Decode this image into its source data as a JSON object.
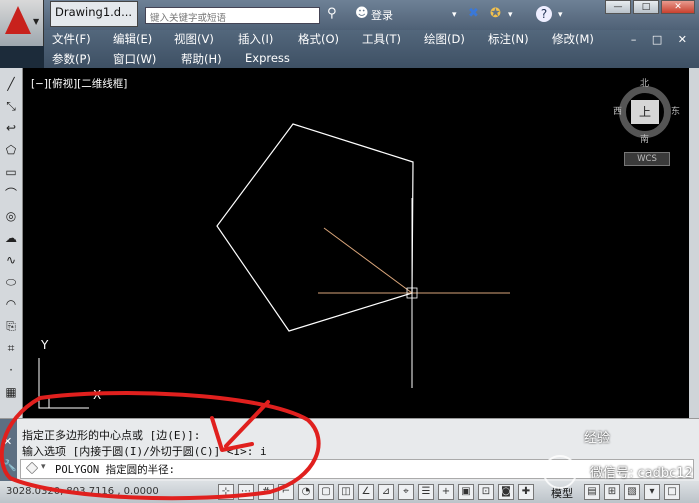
{
  "app": {
    "doc_tab": "Drawing1.d...",
    "search_placeholder": "键入关键字或短语",
    "login_label": "登录",
    "win_ctrls": [
      "—",
      "□",
      "✕"
    ]
  },
  "menu": {
    "row1": [
      "文件(F)",
      "编辑(E)",
      "视图(V)",
      "插入(I)",
      "格式(O)",
      "工具(T)",
      "绘图(D)",
      "标注(N)",
      "修改(M)"
    ],
    "row2": [
      "参数(P)",
      "窗口(W)",
      "帮助(H)",
      "Express"
    ],
    "mdi_ctrls": "– □ ✕"
  },
  "viewport": {
    "label": "[−][俯视][二维线框]",
    "viewcube": {
      "top": "上",
      "north": "北",
      "south": "南",
      "east": "东",
      "west": "西",
      "wcs": "WCS"
    },
    "ucs": {
      "y": "Y",
      "x": "X"
    }
  },
  "command": {
    "history": [
      "指定正多边形的中心点或 [边(E)]:",
      "输入选项 [内接于圆(I)/外切于圆(C)] <I>: i"
    ],
    "prompt": "POLYGON 指定圆的半径:"
  },
  "status": {
    "coords": "3028.0320, 803.7116 , 0.0000",
    "model_label": "模型"
  },
  "watermark": {
    "line1": "经验",
    "line2": "微信号: cadbc12"
  },
  "colors": {
    "canvas": "#000000",
    "geometry": "#ffffff",
    "crosshair": "#d9a57a",
    "annotation": "#e0201e"
  }
}
